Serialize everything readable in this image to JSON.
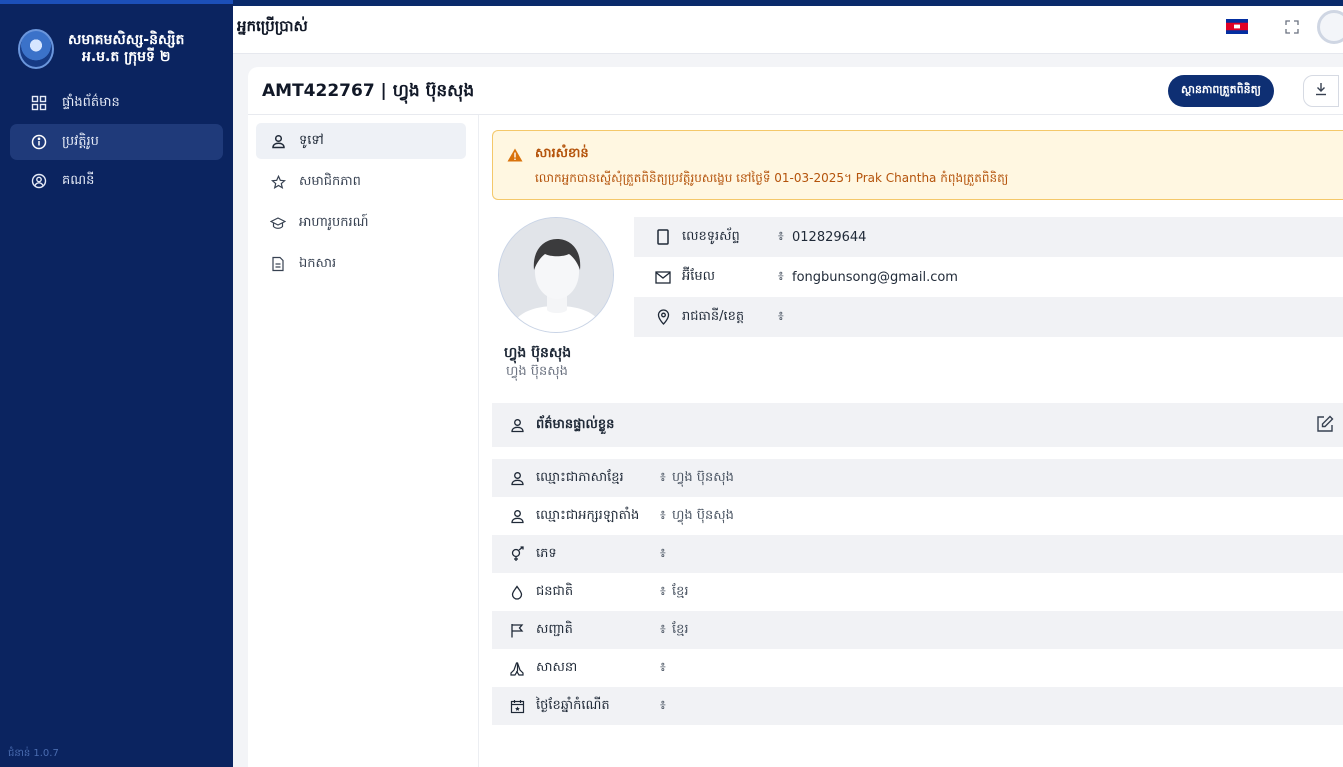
{
  "sidebar": {
    "brand_line1": "សមាគមសិស្ស-និស្សិត",
    "brand_line2": "អ.ម.ត ក្រុមទី ២",
    "items": [
      {
        "label": "ផ្ទាំងព័ត៌មាន",
        "icon": "dashboard-icon",
        "active": false
      },
      {
        "label": "ប្រវត្តិរូប",
        "icon": "info-icon",
        "active": true
      },
      {
        "label": "គណនី",
        "icon": "account-icon",
        "active": false
      }
    ],
    "version": "ជំនាន់ 1.0.7"
  },
  "topbar": {
    "title": "អ្នកប្រើប្រាស់",
    "flag_icon": "cambodia-flag-icon",
    "expand_icon": "fullscreen-icon"
  },
  "header": {
    "title": "AMT422767 | ហ្វុង ប៊ុនសុង",
    "status_button": "ស្ថានភាពត្រួតពិនិត្យ",
    "download_icon": "download-icon"
  },
  "tabs": [
    {
      "label": "ទូទៅ",
      "icon": "user-icon",
      "active": true
    },
    {
      "label": "សមាជិកភាព",
      "icon": "star-icon",
      "active": false
    },
    {
      "label": "អាហារូបករណ៍",
      "icon": "graduation-cap-icon",
      "active": false
    },
    {
      "label": "ឯកសារ",
      "icon": "document-icon",
      "active": false
    }
  ],
  "alert": {
    "title": "សារសំខាន់",
    "message": "លោកអ្នកបានស្នើសុំត្រួតពិនិត្យប្រវត្តិរូបសង្ខេប នៅថ្ងៃទី 01-03-2025។ Prak Chantha កំពុងត្រួតពិនិត្យ"
  },
  "profile": {
    "name": "ហ្វុង ប៊ុនសុង",
    "subname": "ហ្វុង ប៊ុនសុង",
    "contacts": [
      {
        "label": "លេខទូរស័ព្ទ",
        "value": "012829644",
        "icon": "phone-icon"
      },
      {
        "label": "អ៊ីមែល",
        "value": "fongbunsong@gmail.com",
        "icon": "email-icon"
      },
      {
        "label": "រាជធានី/ខេត្ត",
        "value": "",
        "icon": "location-icon"
      }
    ],
    "separator": "៖"
  },
  "personal": {
    "section_title": "ព័ត៌មានផ្ទាល់ខ្លួន",
    "rows": [
      {
        "label": "ឈ្មោះជាភាសាខ្មែរ",
        "value": "ហ្វុង ប៊ុនសុង",
        "icon": "user-icon"
      },
      {
        "label": "ឈ្មោះជាអក្សរឡាតាំង",
        "value": "ហ្វុង ប៊ុនសុង",
        "icon": "user-icon"
      },
      {
        "label": "ភេទ",
        "value": "",
        "icon": "gender-icon"
      },
      {
        "label": "ជនជាតិ",
        "value": "ខ្មែរ",
        "icon": "drop-icon"
      },
      {
        "label": "សញ្ជាតិ",
        "value": "ខ្មែរ",
        "icon": "flag-icon"
      },
      {
        "label": "សាសនា",
        "value": "",
        "icon": "pray-icon"
      },
      {
        "label": "ថ្ងៃខែឆ្នាំកំណើត",
        "value": "",
        "icon": "calendar-icon"
      }
    ]
  },
  "colors": {
    "sidebar_bg": "#0b2460",
    "primary": "#0e2f73",
    "alert_bg": "#fff7e1",
    "alert_text": "#b4530b"
  }
}
